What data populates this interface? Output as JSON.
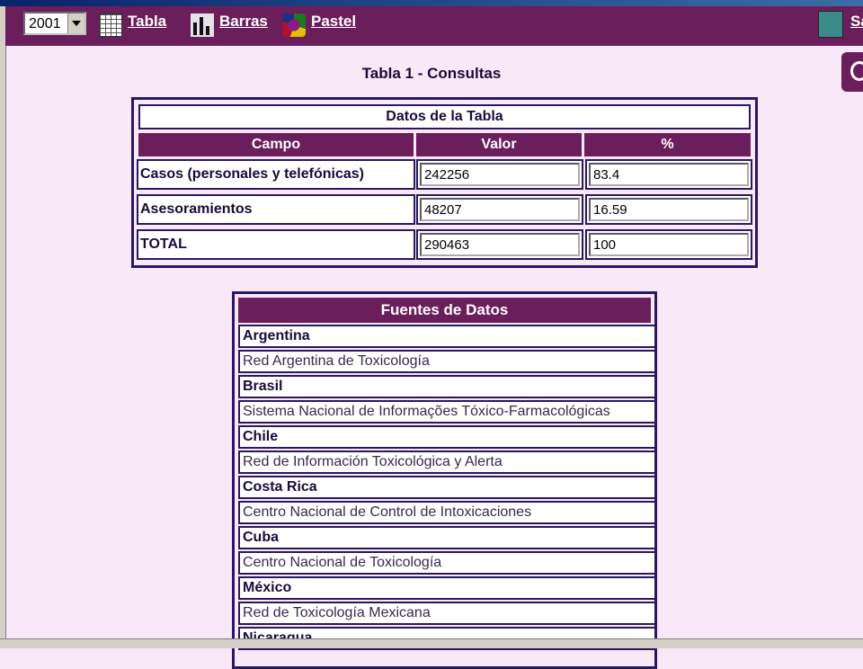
{
  "toolbar": {
    "year": "2001",
    "buttons": [
      {
        "label": "Tabla",
        "icon": "table-icon"
      },
      {
        "label": "Barras",
        "icon": "bar-chart-icon"
      },
      {
        "label": "Pastel",
        "icon": "pie-chart-icon"
      }
    ],
    "exit_label": "Sa"
  },
  "page_title": "Tabla 1 - Consultas",
  "data_table": {
    "caption": "Datos de la Tabla",
    "headers": [
      "Campo",
      "Valor",
      "%"
    ],
    "rows": [
      {
        "campo": "Casos (personales y telefónicas)",
        "valor": "242256",
        "pct": "83.4"
      },
      {
        "campo": "Asesoramientos",
        "valor": "48207",
        "pct": "16.59"
      },
      {
        "campo": "TOTAL",
        "valor": "290463",
        "pct": "100"
      }
    ]
  },
  "sources_table": {
    "title": "Fuentes de Datos",
    "rows": [
      {
        "type": "country",
        "text": "Argentina"
      },
      {
        "type": "source",
        "text": "Red Argentina de Toxicología"
      },
      {
        "type": "country",
        "text": "Brasil"
      },
      {
        "type": "source",
        "text": "Sistema Nacional de Informações Tóxico-Farmacológicas"
      },
      {
        "type": "country",
        "text": "Chile"
      },
      {
        "type": "source",
        "text": "Red de Información Toxicológica y Alerta"
      },
      {
        "type": "country",
        "text": "Costa Rica"
      },
      {
        "type": "source",
        "text": "Centro Nacional de Control de Intoxicaciones"
      },
      {
        "type": "country",
        "text": "Cuba"
      },
      {
        "type": "source",
        "text": "Centro Nacional de Toxicología"
      },
      {
        "type": "country",
        "text": "México"
      },
      {
        "type": "source",
        "text": "Red de Toxicología Mexicana"
      },
      {
        "type": "country",
        "text": "Nicaragua"
      }
    ]
  }
}
